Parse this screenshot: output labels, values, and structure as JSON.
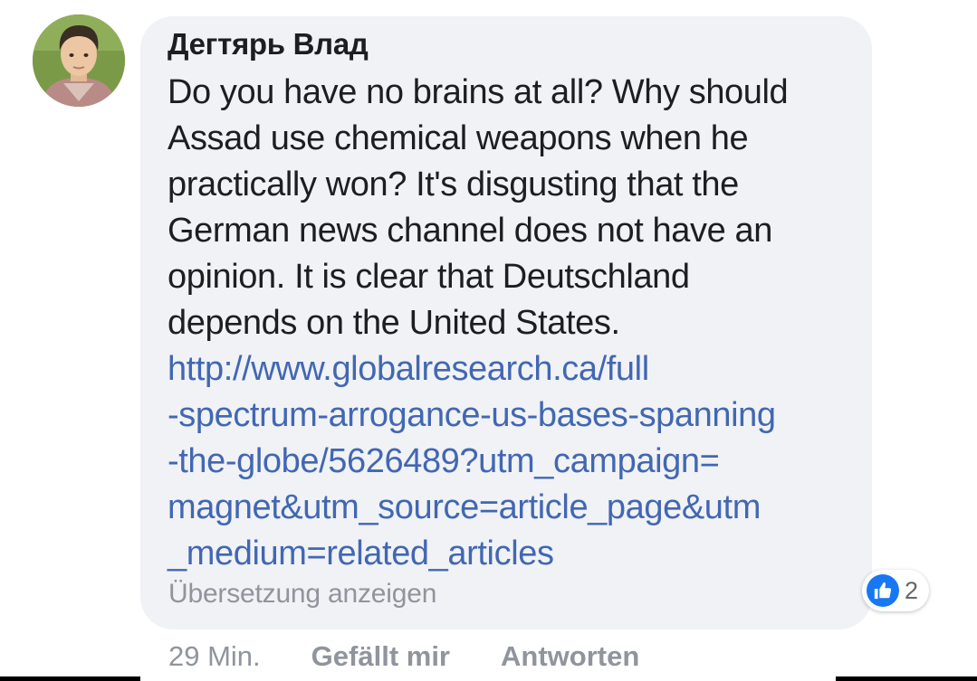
{
  "comment": {
    "author": "Дегтярь Влад",
    "text_lines": [
      "Do you have no brains at all? Why should",
      "Assad use chemical weapons when he",
      "practically won? It's disgusting that the",
      "German news channel does not have an",
      "opinion. It is clear that Deutschland",
      "depends on the United States."
    ],
    "link_lines": [
      "http://www.globalresearch.ca/full",
      "-spectrum-arrogance-us-bases-spanning",
      "-the-globe/5626489?utm_campaign=",
      "magnet&utm_source=article_page&utm",
      "_medium=related_articles"
    ],
    "translate_label": "Übersetzung anzeigen",
    "reaction": {
      "icon": "thumbs-up-icon",
      "count": "2",
      "color": "#1877f2"
    }
  },
  "footer": {
    "time": "29 Min.",
    "like_label": "Gefällt mir",
    "reply_label": "Antworten"
  },
  "colors": {
    "bubble": "#f0f2f5",
    "link": "#4267b2",
    "muted": "#90949c"
  }
}
